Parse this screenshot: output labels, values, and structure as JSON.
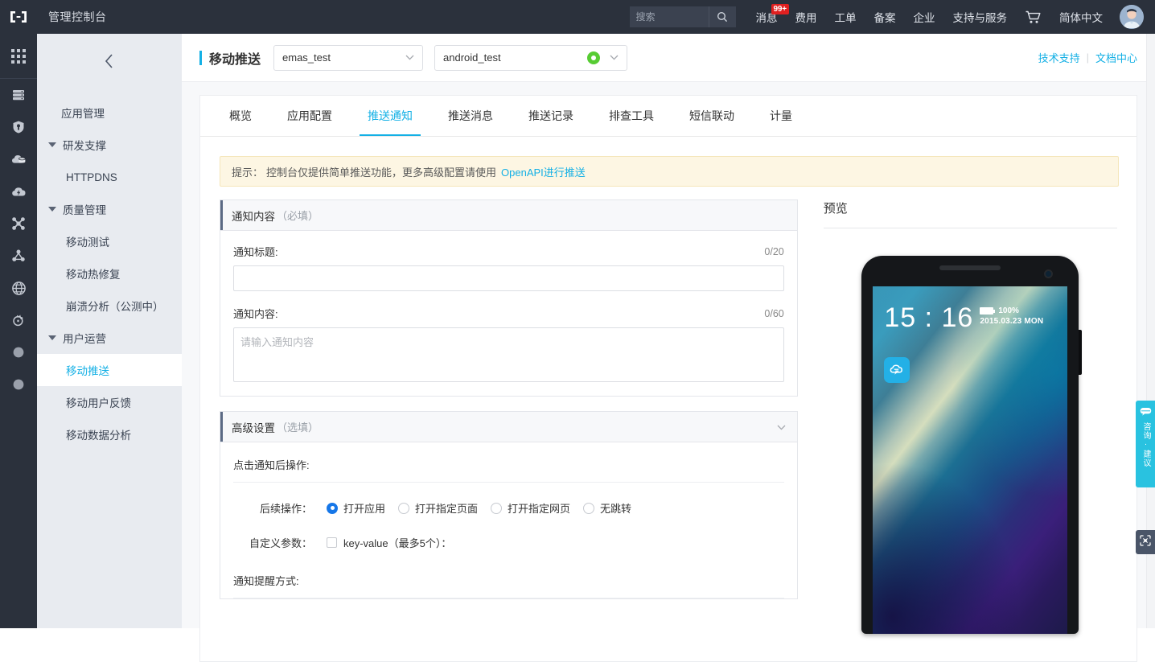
{
  "header": {
    "logo_icon": "cloud-bracket-logo-icon",
    "console_title": "管理控制台",
    "search": {
      "placeholder": "搜索",
      "value": "",
      "icon": "search-icon"
    },
    "nav": [
      {
        "label": "消息",
        "badge": "99+"
      },
      {
        "label": "费用",
        "badge": ""
      },
      {
        "label": "工单",
        "badge": ""
      },
      {
        "label": "备案",
        "badge": ""
      },
      {
        "label": "企业",
        "badge": ""
      },
      {
        "label": "支持与服务",
        "badge": ""
      }
    ],
    "cart_icon": "shopping-cart-icon",
    "language": "简体中文",
    "avatar_icon": "user-avatar-icon"
  },
  "rail": {
    "apps_icon": "app-grid-icon",
    "items": [
      {
        "icon": "server-stack-icon"
      },
      {
        "icon": "shield-icon"
      },
      {
        "icon": "cloud-database-icon"
      },
      {
        "icon": "cloud-bolt-icon"
      },
      {
        "icon": "network-cross-icon"
      },
      {
        "icon": "nodes-triangle-icon"
      },
      {
        "icon": "globe-icon"
      },
      {
        "icon": "security-lock-icon"
      },
      {
        "icon": "circle-icon"
      },
      {
        "icon": "circle-icon"
      }
    ]
  },
  "sidebar": {
    "collapse_icon": "chevron-left-icon",
    "items": [
      {
        "label": "应用管理",
        "type": "item",
        "level": 1,
        "active": false
      },
      {
        "label": "研发支撑",
        "type": "group",
        "active": false
      },
      {
        "label": "HTTPDNS",
        "type": "item",
        "level": 2,
        "active": false
      },
      {
        "label": "质量管理",
        "type": "group",
        "active": false
      },
      {
        "label": "移动测试",
        "type": "item",
        "level": 2,
        "active": false
      },
      {
        "label": "移动热修复",
        "type": "item",
        "level": 2,
        "active": false
      },
      {
        "label": "崩溃分析（公测中）",
        "type": "item",
        "level": 2,
        "active": false
      },
      {
        "label": "用户运营",
        "type": "group",
        "active": false
      },
      {
        "label": "移动推送",
        "type": "item",
        "level": 2,
        "active": true
      },
      {
        "label": "移动用户反馈",
        "type": "item",
        "level": 2,
        "active": false
      },
      {
        "label": "移动数据分析",
        "type": "item",
        "level": 2,
        "active": false
      }
    ]
  },
  "product_header": {
    "title": "移动推送",
    "project_select": {
      "value": "emas_test",
      "chevron": "chevron-down-icon"
    },
    "app_select": {
      "value": "android_test",
      "status_icon": "green-status-dot-icon",
      "chevron": "chevron-down-icon"
    },
    "links": [
      {
        "label": "技术支持"
      },
      {
        "label": "文档中心"
      }
    ],
    "link_separator": "|"
  },
  "tabs": [
    {
      "label": "概览",
      "active": false
    },
    {
      "label": "应用配置",
      "active": false
    },
    {
      "label": "推送通知",
      "active": true
    },
    {
      "label": "推送消息",
      "active": false
    },
    {
      "label": "推送记录",
      "active": false
    },
    {
      "label": "排查工具",
      "active": false
    },
    {
      "label": "短信联动",
      "active": false
    },
    {
      "label": "计量",
      "active": false
    }
  ],
  "tip": {
    "prefix": "提示：",
    "text": "控制台仅提供简单推送功能，更多高级配置请使用",
    "link": "OpenAPI进行推送"
  },
  "notification_panel": {
    "title": "通知内容",
    "subtitle": "（必填）",
    "title_field": {
      "label": "通知标题:",
      "counter": "0/20",
      "value": "",
      "placeholder": ""
    },
    "content_field": {
      "label": "通知内容:",
      "counter": "0/60",
      "value": "",
      "placeholder": "请输入通知内容"
    }
  },
  "advanced_panel": {
    "title": "高级设置",
    "subtitle": "（选填）",
    "toggle_icon": "chevron-down-icon",
    "section_click_action": "点击通知后操作:",
    "followup": {
      "label": "后续操作：",
      "options": [
        {
          "label": "打开应用",
          "selected": true
        },
        {
          "label": "打开指定页面",
          "selected": false
        },
        {
          "label": "打开指定网页",
          "selected": false
        },
        {
          "label": "无跳转",
          "selected": false
        }
      ]
    },
    "custom_params": {
      "label": "自定义参数：",
      "checkbox_label": "key-value（最多5个）：",
      "checked": false
    },
    "section_notify_style": "通知提醒方式:"
  },
  "preview": {
    "title": "预览",
    "phone": {
      "clock": "15 : 16",
      "battery": "100%",
      "date": "2015.03.23 MON",
      "app_icon": "cloud-message-app-icon",
      "camera_icon": "front-camera-icon"
    }
  },
  "floating": {
    "chat": {
      "icon": "speech-bubble-icon",
      "text": "咨询·建议"
    },
    "feedback": {
      "icon": "feedback-square-icon"
    }
  },
  "colors": {
    "brand_cyan": "#14b0e5",
    "header_dark": "#2b313c",
    "sidebar_bg": "#e8ebf0",
    "tip_bg": "#fdf6e3",
    "radio_blue": "#1677e8",
    "status_green": "#57cc33",
    "badge_red": "#e02020",
    "float_chat": "#29c2e0"
  }
}
